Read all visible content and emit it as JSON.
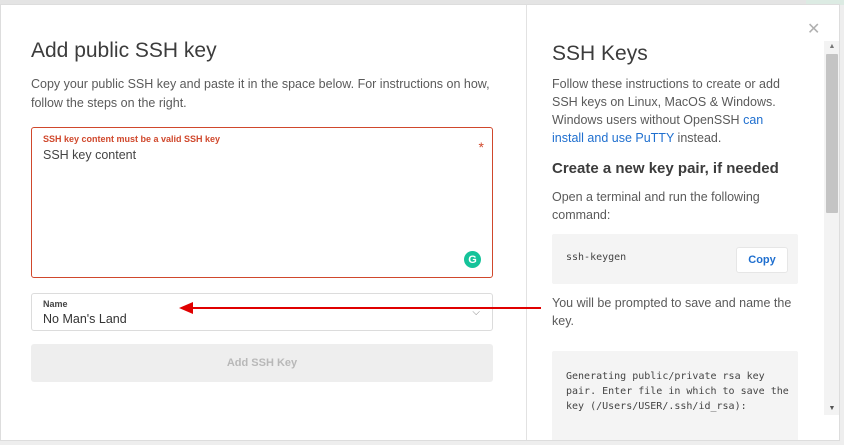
{
  "left": {
    "title": "Add public SSH key",
    "intro": "Copy your public SSH key and paste it in the space below. For instructions on how, follow the steps on the right.",
    "key_field": {
      "error": "SSH key content must be a valid SSH key",
      "placeholder": "SSH key content",
      "required_marker": "*",
      "grammarly_badge": "G"
    },
    "name_field": {
      "label": "Name",
      "value": "No Man's Land"
    },
    "submit_label": "Add SSH Key"
  },
  "right": {
    "title": "SSH Keys",
    "intro_text": "Follow these instructions to create or add SSH keys on Linux, MacOS & Windows. Windows users without OpenSSH ",
    "intro_link": "can install and use PuTTY",
    "intro_tail": " instead.",
    "subheading": "Create a new key pair, if needed",
    "step1": "Open a terminal and run the following command:",
    "command": "ssh-keygen",
    "copy_label": "Copy",
    "step2": "You will be prompted to save and name the key.",
    "output": "Generating public/private rsa key pair. Enter file in which to save the key (/Users/USER/.ssh/id_rsa):"
  },
  "icons": {
    "close": "close-icon",
    "chevron": "chevron-down-icon",
    "arrow": "red-arrow-annotation"
  },
  "colors": {
    "error": "#d0482c",
    "link": "#1f6fcf",
    "annotation_arrow": "#e00000",
    "grammarly": "#15c39a"
  }
}
